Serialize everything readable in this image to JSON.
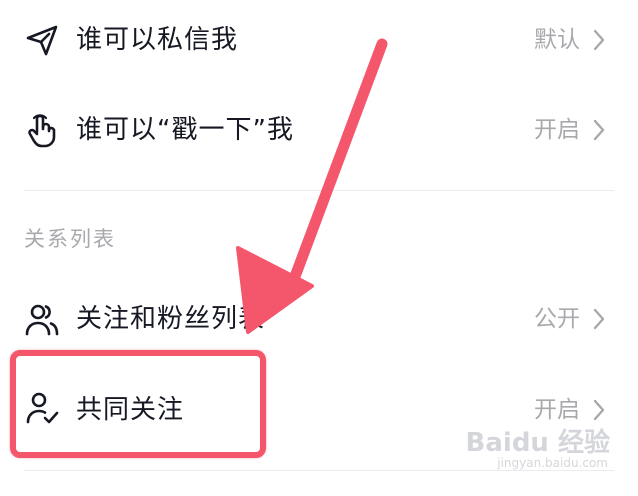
{
  "privacy_rows": [
    {
      "label": "谁可以私信我",
      "value": "默认",
      "icon": "send-icon"
    },
    {
      "label": "谁可以“戳一下”我",
      "value": "开启",
      "icon": "poke-hand-icon"
    }
  ],
  "relations_section": {
    "title": "关系列表",
    "rows": [
      {
        "label": "关注和粉丝列表",
        "value": "公开",
        "icon": "users-icon"
      },
      {
        "label": "共同关注",
        "value": "开启",
        "icon": "user-check-icon"
      }
    ]
  },
  "annotation": {
    "color": "#f4566c",
    "arrow": "arrow-pointing-to-common-follow"
  },
  "watermark": {
    "logo": "Baidu 经验",
    "url": "jingyan.baidu.com"
  }
}
